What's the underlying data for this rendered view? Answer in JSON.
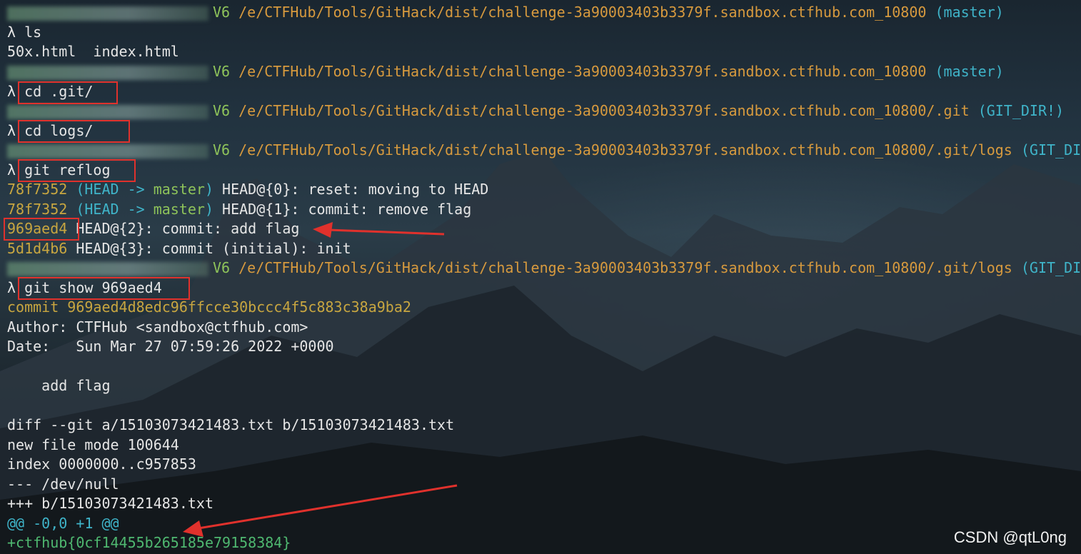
{
  "lines": [
    {
      "path": "/e/CTFHub/Tools/GitHack/dist/challenge-3a90003403b3379f.sandbox.ctfhub.com_10800",
      "branch": "(master)"
    },
    {
      "prompt": "λ",
      "cmd": "ls"
    },
    {
      "text": "50x.html  index.html"
    },
    {
      "path": "/e/CTFHub/Tools/GitHack/dist/challenge-3a90003403b3379f.sandbox.ctfhub.com_10800",
      "branch": "(master)"
    },
    {
      "prompt": "λ",
      "cmd": "cd .git/"
    },
    {
      "path": "/e/CTFHub/Tools/GitHack/dist/challenge-3a90003403b3379f.sandbox.ctfhub.com_10800/.git",
      "branch": "(GIT_DIR!)"
    },
    {
      "prompt": "λ",
      "cmd": "cd logs/"
    },
    {
      "path": "/e/CTFHub/Tools/GitHack/dist/challenge-3a90003403b3379f.sandbox.ctfhub.com_10800/.git/logs",
      "branch": "(GIT_DIR"
    },
    {
      "prompt": "λ",
      "cmd": "git reflog"
    },
    {
      "hash": "78f7352",
      "ref_open": "(HEAD -> ",
      "ref_branch": "master",
      "ref_close": ")",
      "rest": " HEAD@{0}: reset: moving to HEAD"
    },
    {
      "hash": "78f7352",
      "ref_open": "(HEAD -> ",
      "ref_branch": "master",
      "ref_close": ")",
      "rest": " HEAD@{1}: commit: remove flag"
    },
    {
      "hash": "969aed4",
      "rest": " HEAD@{2}: commit: add flag"
    },
    {
      "hash": "5d1d4b6",
      "rest": " HEAD@{3}: commit (initial): init"
    },
    {
      "path": "/e/CTFHub/Tools/GitHack/dist/challenge-3a90003403b3379f.sandbox.ctfhub.com_10800/.git/logs",
      "branch": "(GIT_DIR"
    },
    {
      "prompt": "λ",
      "cmd": "git show 969aed4"
    },
    {
      "text": "commit 969aed4d8edc96ffcce30bccc4f5c883c38a9ba2"
    },
    {
      "text": "Author: CTFHub <sandbox@ctfhub.com>"
    },
    {
      "text": "Date:   Sun Mar 27 07:59:26 2022 +0000"
    },
    {
      "text": ""
    },
    {
      "text": "    add flag"
    },
    {
      "text": ""
    },
    {
      "text": "diff --git a/15103073421483.txt b/15103073421483.txt"
    },
    {
      "text": "new file mode 100644"
    },
    {
      "text": "index 0000000..c957853"
    },
    {
      "text": "--- /dev/null"
    },
    {
      "text": "+++ b/15103073421483.txt"
    },
    {
      "text": "@@ -0,0 +1 @@"
    },
    {
      "text": "+ctfhub{0cf14455b265185e79158384}"
    }
  ],
  "prompt_suffix": "V6",
  "watermark": "CSDN @qtL0ng",
  "colors": {
    "path": "#d79a3e",
    "branch": "#3fb4c9",
    "hash": "#c8a640",
    "highlight_box": "#e0312c",
    "flag": "#4fb870"
  }
}
